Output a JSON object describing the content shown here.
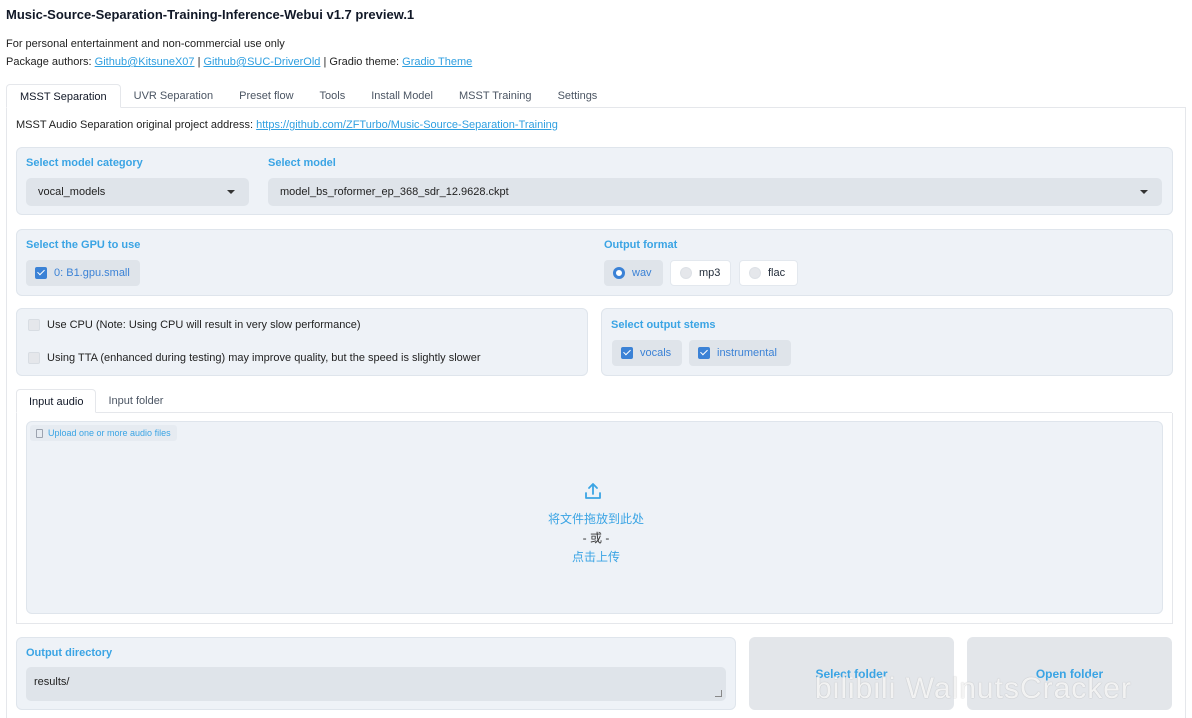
{
  "header": {
    "title": "Music-Source-Separation-Training-Inference-Webui v1.7 preview.1",
    "notice": "For personal entertainment and non-commercial use only",
    "authors_prefix": "Package authors: ",
    "author1": "Github@KitsuneX07",
    "sep": " | ",
    "author2": "Github@SUC-DriverOld",
    "theme_prefix": " | Gradio theme: ",
    "theme_link": "Gradio Theme"
  },
  "tabs": [
    "MSST Separation",
    "UVR Separation",
    "Preset flow",
    "Tools",
    "Install Model",
    "MSST Training",
    "Settings"
  ],
  "project": {
    "prefix": "MSST Audio Separation original project address: ",
    "url": "https://github.com/ZFTurbo/Music-Source-Separation-Training"
  },
  "model": {
    "category_label": "Select model category",
    "category_value": "vocal_models",
    "model_label": "Select model",
    "model_value": "model_bs_roformer_ep_368_sdr_12.9628.ckpt"
  },
  "gpu": {
    "label": "Select the GPU to use",
    "option": "0: B1.gpu.small",
    "checked": true
  },
  "output_format": {
    "label": "Output format",
    "options": [
      "wav",
      "mp3",
      "flac"
    ],
    "selected": "wav"
  },
  "options": {
    "use_cpu": "Use CPU (Note: Using CPU will result in very slow performance)",
    "use_tta": "Using TTA (enhanced during testing) may improve quality, but the speed is slightly slower"
  },
  "stems": {
    "label": "Select output stems",
    "items": [
      "vocals",
      "instrumental"
    ]
  },
  "input": {
    "tabs": [
      "Input audio",
      "Input folder"
    ],
    "upload_label": "Upload one or more audio files",
    "drop_text": "将文件拖放到此处",
    "or_text": "- 或 -",
    "click_text": "点击上传"
  },
  "output": {
    "label": "Output directory",
    "value": "results/",
    "select_folder": "Select folder",
    "open_folder": "Open folder"
  },
  "colors": {
    "accent": "#3aa4e4",
    "checkbox": "#3b82d6",
    "panel": "#eef2f7"
  },
  "watermark": "bilibili WalnutsCracker"
}
